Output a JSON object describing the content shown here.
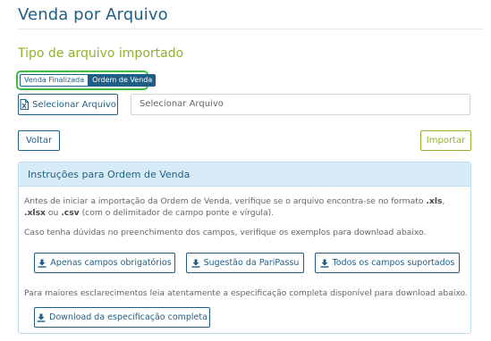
{
  "page": {
    "title": "Venda por Arquivo"
  },
  "section": {
    "title": "Tipo de arquivo importado"
  },
  "file_type_toggle": {
    "options": [
      "Venda Finalizada",
      "Ordem de Venda"
    ],
    "selected": "Ordem de Venda"
  },
  "file_select": {
    "button_label": "Selecionar Arquivo",
    "field_value": "Selecionar Arquivo",
    "button_icon": "excel-file-icon"
  },
  "actions": {
    "back_label": "Voltar",
    "import_label": "Importar"
  },
  "instructions": {
    "title": "Instruções para Ordem de Venda",
    "para1_pre": "Antes de iniciar a importação da Ordem de Venda, verifique se o arquivo encontra-se no formato ",
    "fmt_xls": ".xls",
    "sep1": ", ",
    "fmt_xlsx": ".xlsx",
    "sep2": " ou ",
    "fmt_csv": ".csv",
    "para1_post": " (com o delimitador de campo ponte e vírgula).",
    "para2": "Caso tenha dúvidas no preenchimento dos campos, verifique os exemplos para download abaixo.",
    "downloads": [
      "Apenas campos obrigatórios",
      "Sugestão da PariPassu",
      "Todos os campos suportados"
    ],
    "para3": "Para maiores esclarecimentos leia atentamente a especificação completa disponível para download abaixo.",
    "spec_download": "Download da especificação completa",
    "download_icon": "download-icon"
  },
  "colors": {
    "primary": "#1f5f86",
    "accent_green": "#8fb230",
    "toggle_border": "#3bbf3d",
    "panel_header": "#d7ecf6"
  }
}
